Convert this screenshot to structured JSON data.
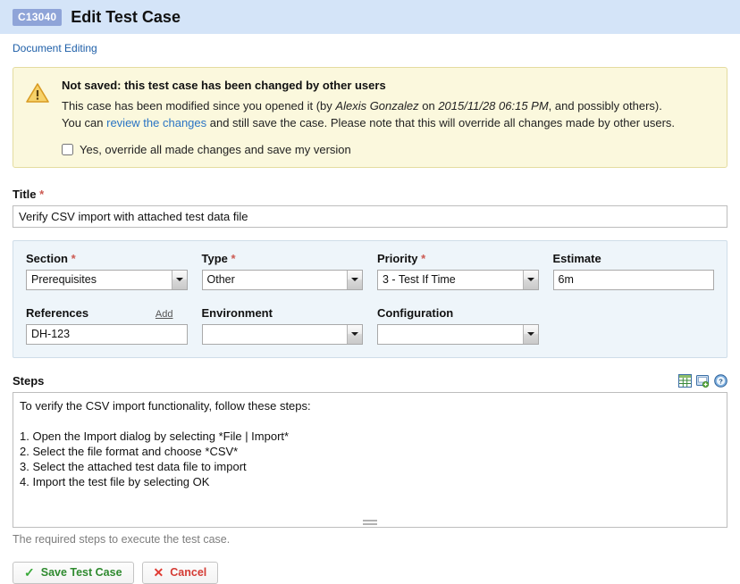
{
  "header": {
    "case_id": "C13040",
    "title": "Edit Test Case",
    "badge_color": "#8fa4d8",
    "bar_color": "#d4e4f8"
  },
  "breadcrumb": {
    "label": "Document Editing"
  },
  "warning": {
    "icon": "warning-triangle-icon",
    "title": "Not saved: this test case has been changed by other users",
    "line1_prefix": "This case has been modified since you opened it (by ",
    "user": "Alexis Gonzalez",
    "line1_mid": " on ",
    "timestamp": "2015/11/28 06:15 PM",
    "line1_suffix": ", and possibly others).",
    "line2_prefix": "You can ",
    "link": "review the changes",
    "line2_suffix": " and still save the case. Please note that this will override all changes made by other users.",
    "checkbox_label": "Yes, override all made changes and save my version",
    "checkbox_checked": false,
    "bg_color": "#fbf8dd",
    "border_color": "#e4dca0"
  },
  "title_field": {
    "label": "Title",
    "required": "*",
    "value": "Verify CSV import with attached test data file",
    "placeholder": ""
  },
  "properties": {
    "section": {
      "label": "Section",
      "required": "*",
      "value": "Prerequisites"
    },
    "type": {
      "label": "Type",
      "required": "*",
      "value": "Other"
    },
    "priority": {
      "label": "Priority",
      "required": "*",
      "value": "3 - Test If Time"
    },
    "estimate": {
      "label": "Estimate",
      "value": "6m",
      "placeholder": ""
    },
    "references": {
      "label": "References",
      "add_link": "Add",
      "value": "DH-123",
      "placeholder": ""
    },
    "environment": {
      "label": "Environment",
      "value": ""
    },
    "configuration": {
      "label": "Configuration",
      "value": ""
    }
  },
  "steps": {
    "label": "Steps",
    "toolbar": [
      {
        "name": "insert-table-icon",
        "title": "Insert table"
      },
      {
        "name": "add-image-icon",
        "title": "Add image"
      },
      {
        "name": "help-icon",
        "title": "Help"
      }
    ],
    "value": "To verify the CSV import functionality, follow these steps:\n\n1. Open the Import dialog by selecting *File | Import*\n2. Select the file format and choose *CSV*\n3. Select the attached test data file to import\n4. Import the test file by selecting OK",
    "hint": "The required steps to execute the test case."
  },
  "actions": {
    "save_label": "Save Test Case",
    "cancel_label": "Cancel",
    "save_color": "#2f8a2f",
    "cancel_color": "#d43b34"
  }
}
